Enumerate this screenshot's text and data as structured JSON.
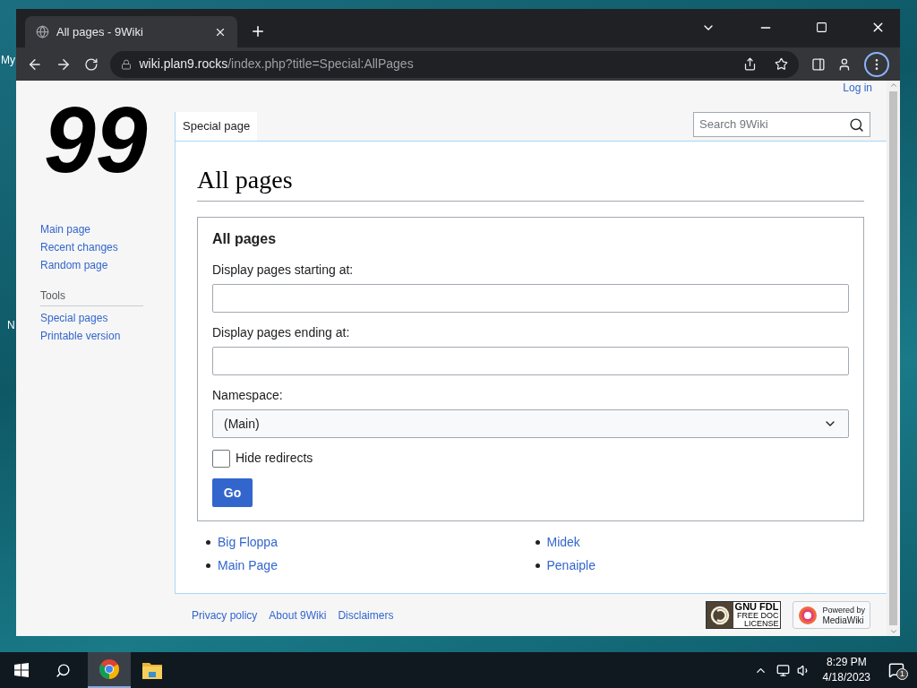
{
  "desktop": {
    "icon_labels": [
      "My",
      "N"
    ]
  },
  "browser": {
    "tab": {
      "title": "All pages - 9Wiki",
      "selected": true
    },
    "url": {
      "host": "wiki.plan9.rocks",
      "path": "/index.php?title=Special:AllPages"
    }
  },
  "page": {
    "login": "Log in",
    "logo": "99",
    "navigation": [
      "Main page",
      "Recent changes",
      "Random page"
    ],
    "tools": {
      "heading": "Tools",
      "items": [
        "Special pages",
        "Printable version"
      ]
    },
    "tab": {
      "label": "Special page",
      "selected": true
    },
    "search": {
      "placeholder": "Search 9Wiki"
    },
    "title": "All pages",
    "form": {
      "legend": "All pages",
      "fields": [
        {
          "kind": "text",
          "label": "Display pages starting at:"
        },
        {
          "kind": "text",
          "label": "Display pages ending at:"
        },
        {
          "kind": "select",
          "label": "Namespace:",
          "value": "(Main)"
        },
        {
          "kind": "checkbox",
          "label": "Hide redirects",
          "checked": false
        }
      ],
      "button": "Go"
    },
    "pages": [
      [
        "Big Floppa",
        "Main Page"
      ],
      [
        "Midek",
        "Penaiple"
      ]
    ],
    "footer": {
      "links": [
        "Privacy policy",
        "About 9Wiki",
        "Disclaimers"
      ],
      "license": [
        "GNU FDL",
        "FREE DOC",
        "LICENSE"
      ],
      "powered": [
        "Powered by",
        "MediaWiki"
      ]
    }
  },
  "taskbar": {
    "time": "8:29 PM",
    "date": "4/18/2023",
    "notifications": "1"
  }
}
